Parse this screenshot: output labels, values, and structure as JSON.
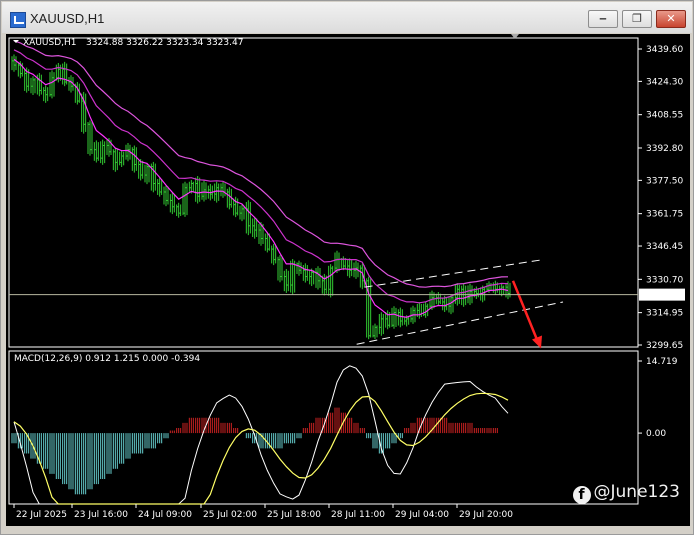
{
  "window": {
    "title": "XAUUSD,H1"
  },
  "chart_data": [
    {
      "type": "candlestick",
      "title": "XAUUSD,H1",
      "ohlc_readout": "3324.88 3326.22 3323.34 3323.47",
      "current_price": 3323.47,
      "price_ticks": [
        "3439.60",
        "3424.30",
        "3408.55",
        "3392.80",
        "3377.50",
        "3361.75",
        "3346.45",
        "3330.70",
        "3314.95",
        "3299.65"
      ],
      "ylim": [
        3299.65,
        3439.6
      ],
      "x_ticks": [
        "22 Jul 2025",
        "23 Jul 16:00",
        "24 Jul 09:00",
        "25 Jul 02:00",
        "25 Jul 18:00",
        "28 Jul 11:00",
        "29 Jul 04:00",
        "29 Jul 20:00"
      ],
      "close_path": [
        3432,
        3428,
        3422,
        3425,
        3420,
        3418,
        3426,
        3430,
        3424,
        3422,
        3415,
        3404,
        3392,
        3388,
        3394,
        3391,
        3386,
        3389,
        3392,
        3385,
        3380,
        3384,
        3376,
        3372,
        3368,
        3365,
        3362,
        3374,
        3376,
        3370,
        3373,
        3371,
        3374,
        3372,
        3366,
        3362,
        3364,
        3356,
        3354,
        3350,
        3345,
        3340,
        3332,
        3328,
        3338,
        3335,
        3332,
        3334,
        3330,
        3326,
        3336,
        3340,
        3337,
        3335,
        3336,
        3330,
        3304,
        3308,
        3312,
        3309,
        3315,
        3311,
        3312,
        3316,
        3314,
        3318,
        3322,
        3320,
        3318,
        3322,
        3326,
        3322,
        3325,
        3324,
        3326,
        3328,
        3326,
        3327,
        3324
      ],
      "moving_average_colors": [
        "#ff33ff",
        "#cc33cc",
        "#dd55dd"
      ],
      "channel_color": "#ffffff",
      "arrow_color": "#ff2222",
      "up_color": "#33cc33",
      "down_color": "#33cc33"
    },
    {
      "type": "histogram+line",
      "title": "MACD(12,26,9) 0.912 1.215 0.000 -0.394",
      "y_ticks": [
        "14.719",
        "0.00",
        "-13.9"
      ],
      "ylim": [
        -13.9,
        14.719
      ],
      "histogram": [
        -2,
        -3,
        -4,
        -5,
        -6,
        -7,
        -8,
        -9,
        -10,
        -11,
        -12,
        -12,
        -11,
        -10,
        -9,
        -8,
        -7,
        -6,
        -5,
        -4,
        -4,
        -3,
        -3,
        -2,
        -1,
        0.5,
        1,
        2,
        3,
        3,
        3,
        3,
        3,
        2,
        2,
        1,
        0,
        -1,
        -2,
        -3,
        -3,
        -3,
        -3,
        -2,
        -2,
        -1,
        1,
        2,
        3,
        3,
        4,
        5,
        4,
        3,
        2,
        1,
        -1,
        -3,
        -4,
        -3,
        -2,
        -1,
        1,
        2,
        3,
        3,
        3,
        3,
        3,
        2,
        2,
        2,
        2,
        1,
        1,
        1,
        1,
        0,
        0
      ],
      "macd_line_color": "#ffffff",
      "signal_line_color": "#ffff66",
      "hist_positive_color": "#cc2222",
      "hist_negative_color": "#66cccc"
    }
  ],
  "watermark": {
    "text": "@June123"
  }
}
